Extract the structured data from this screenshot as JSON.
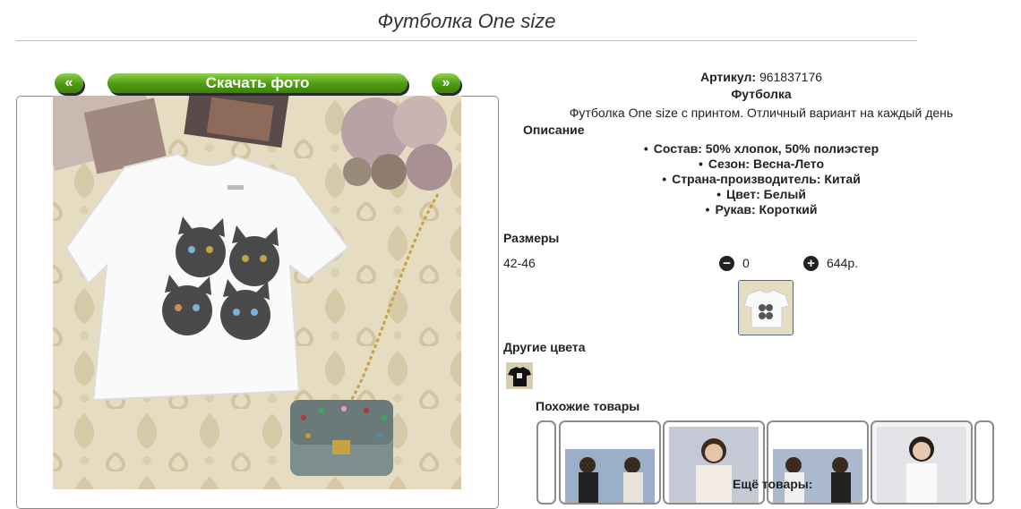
{
  "page": {
    "title": "Футболка One size"
  },
  "gallery": {
    "prev_label": "«",
    "next_label": "»",
    "download_label": "Скачать фото"
  },
  "product": {
    "sku_label": "Артикул:",
    "sku_value": "961837176",
    "name": "Футболка",
    "description": "Футболка One size с принтом. Отличный вариант на каждый день",
    "description_heading": "Описание",
    "attributes": [
      "Состав: 50% хлопок, 50% полиэстер",
      "Сезон: Весна-Лето",
      "Страна-производитель: Китай",
      "Цвет: Белый",
      "Рукав: Короткий"
    ]
  },
  "sizes": {
    "heading": "Размеры",
    "rows": [
      {
        "size": "42-46",
        "qty": "0",
        "price": "644р."
      }
    ],
    "minus_icon": "minus-circle-icon",
    "plus_icon": "plus-circle-icon"
  },
  "other_colors": {
    "heading": "Другие цвета"
  },
  "similar": {
    "heading": "Похожие товары",
    "more_label": "Ещё товары:"
  }
}
